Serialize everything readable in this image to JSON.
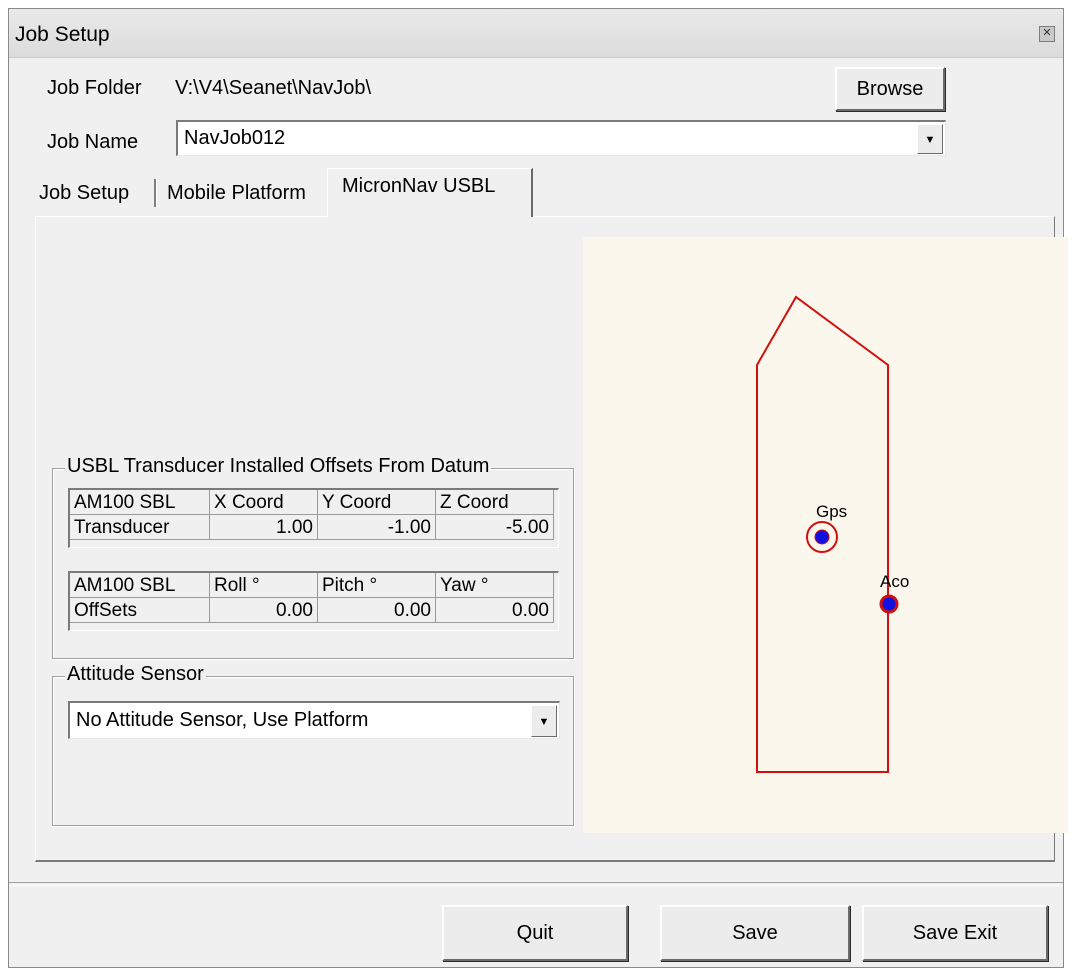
{
  "window": {
    "title": "Job Setup"
  },
  "job_folder": {
    "label": "Job Folder",
    "path": "V:\\V4\\Seanet\\NavJob\\"
  },
  "browse_button": {
    "label": "Browse"
  },
  "job_name": {
    "label": "Job Name",
    "value": "NavJob012"
  },
  "tabs": [
    {
      "label": "Job Setup"
    },
    {
      "label": "Mobile Platform"
    },
    {
      "label": "MicronNav USBL"
    }
  ],
  "offsets_group": {
    "title": "USBL Transducer Installed Offsets From Datum",
    "coord_table": {
      "headers": [
        "AM100 SBL",
        "X Coord",
        "Y Coord",
        "Z Coord"
      ],
      "row": [
        "Transducer",
        "1.00",
        "-1.00",
        "-5.00"
      ]
    },
    "angle_table": {
      "headers": [
        "AM100 SBL",
        "Roll °",
        "Pitch °",
        "Yaw °"
      ],
      "row": [
        "OffSets",
        "0.00",
        "0.00",
        "0.00"
      ]
    }
  },
  "attitude_group": {
    "title": "Attitude Sensor",
    "selected": "No Attitude Sensor, Use Platform"
  },
  "diagram": {
    "gps_label": "Gps",
    "aco_label": "Aco",
    "outline_color": "#d01010",
    "marker_fill": "#1010e0",
    "background": "#fbf7ec"
  },
  "footer_buttons": {
    "quit": "Quit",
    "save": "Save",
    "save_exit": "Save Exit"
  },
  "icons": {
    "close": "close-icon",
    "dropdown": "dropdown-arrow-icon"
  }
}
